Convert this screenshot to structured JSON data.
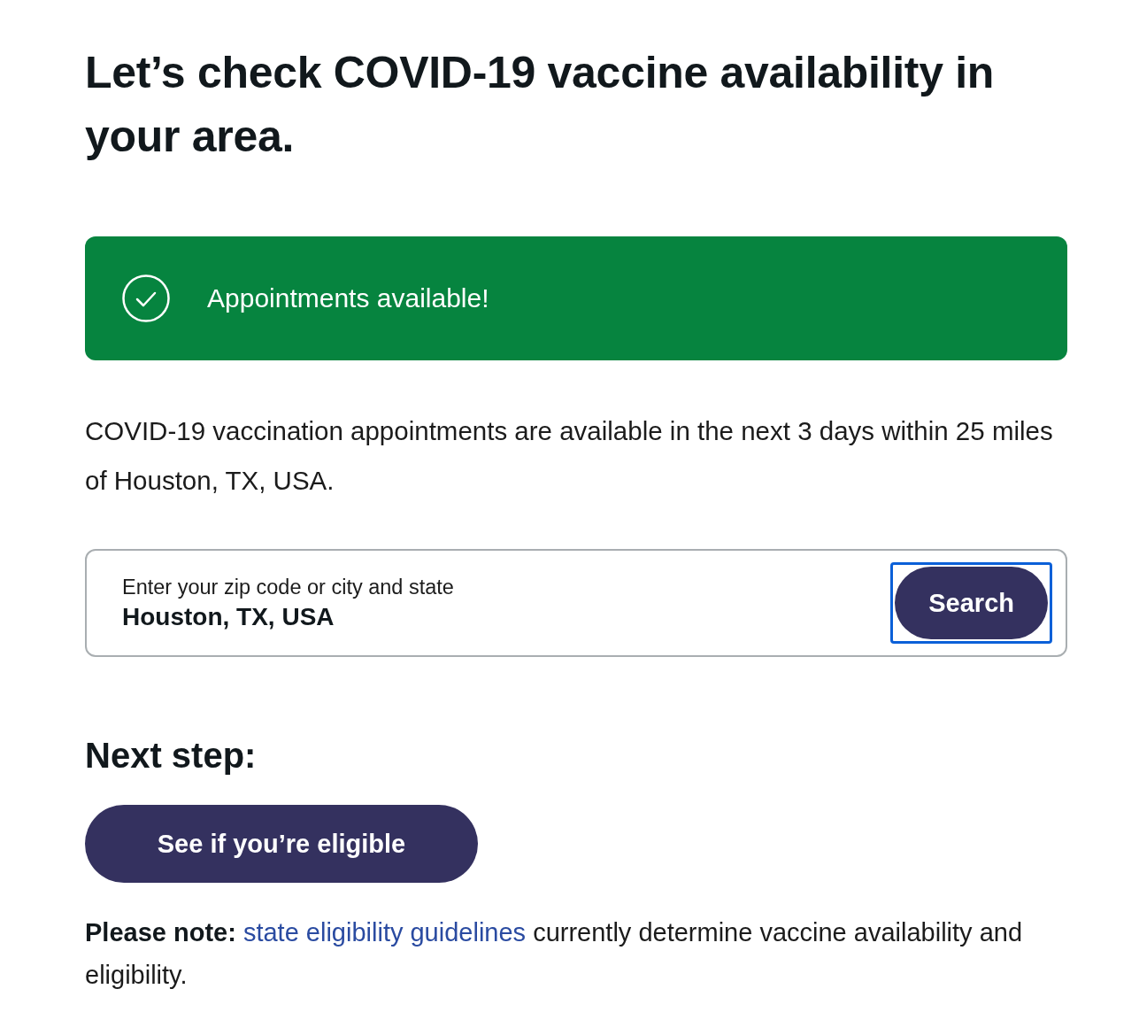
{
  "heading": "Let’s check COVID-19 vaccine availability in your area.",
  "status_banner": {
    "kind": "success",
    "text": "Appointments available!"
  },
  "summary": "COVID-19 vaccination appointments are available in the next 3 days within 25 miles of Houston, TX, USA.",
  "search": {
    "label": "Enter your zip code or city and state",
    "value": "Houston, TX, USA",
    "button": {
      "label": "Search",
      "focused": true
    }
  },
  "next_step": {
    "heading": "Next step:",
    "button": "See if you’re eligible"
  },
  "note": {
    "lead": "Please note:",
    "link": "state eligibility guidelines",
    "text": "currently determine vaccine availability and eligibility."
  }
}
